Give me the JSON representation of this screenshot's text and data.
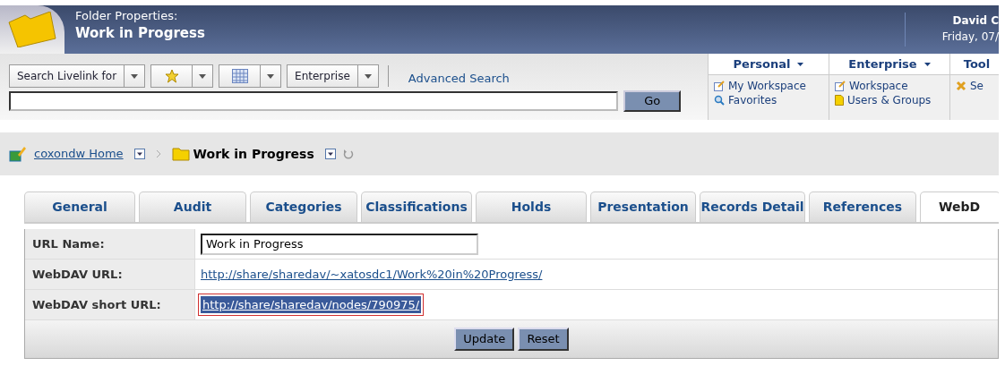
{
  "header": {
    "subtitle": "Folder Properties:",
    "title": "Work in Progress",
    "user": "David C",
    "date": "Friday, 07/"
  },
  "search": {
    "selects": [
      {
        "kind": "text",
        "label": "Search Livelink for"
      },
      {
        "kind": "star"
      },
      {
        "kind": "calendar"
      },
      {
        "kind": "text",
        "label": "Enterprise"
      }
    ],
    "advanced": "Advanced Search",
    "go": "Go"
  },
  "menus": [
    {
      "label": "Personal",
      "dropdown": true,
      "links": [
        {
          "kind": "edit",
          "label": "My Workspace"
        },
        {
          "kind": "favorites",
          "label": "Favorites"
        }
      ]
    },
    {
      "label": "Enterprise",
      "dropdown": true,
      "links": [
        {
          "kind": "edit",
          "label": "Workspace"
        },
        {
          "kind": "users",
          "label": "Users & Groups"
        }
      ]
    },
    {
      "label": "Tool",
      "dropdown": false,
      "links": [
        {
          "kind": "settings",
          "label": "Se"
        }
      ]
    }
  ],
  "breadcrumb": {
    "home": "coxondw Home",
    "current": "Work in Progress"
  },
  "tabs": [
    {
      "label": "General",
      "selected": false
    },
    {
      "label": "Audit",
      "selected": false
    },
    {
      "label": "Categories",
      "selected": false
    },
    {
      "label": "Classifications",
      "selected": false
    },
    {
      "label": "Holds",
      "selected": false
    },
    {
      "label": "Presentation",
      "selected": false
    },
    {
      "label": "Records Detail",
      "selected": false
    },
    {
      "label": "References",
      "selected": false
    },
    {
      "label": "WebD",
      "selected": true
    }
  ],
  "rows": [
    {
      "kind": "input",
      "label": "URL Name:",
      "value": "Work in Progress"
    },
    {
      "kind": "link",
      "label": "WebDAV URL:",
      "value": "http://share/sharedav/~xatosdc1/Work%20in%20Progress/",
      "highlighted": false
    },
    {
      "kind": "link",
      "label": "WebDAV short URL:",
      "value": "http://share/sharedav/nodes/790975/",
      "highlighted": true
    }
  ],
  "buttons": [
    "Update",
    "Reset"
  ]
}
